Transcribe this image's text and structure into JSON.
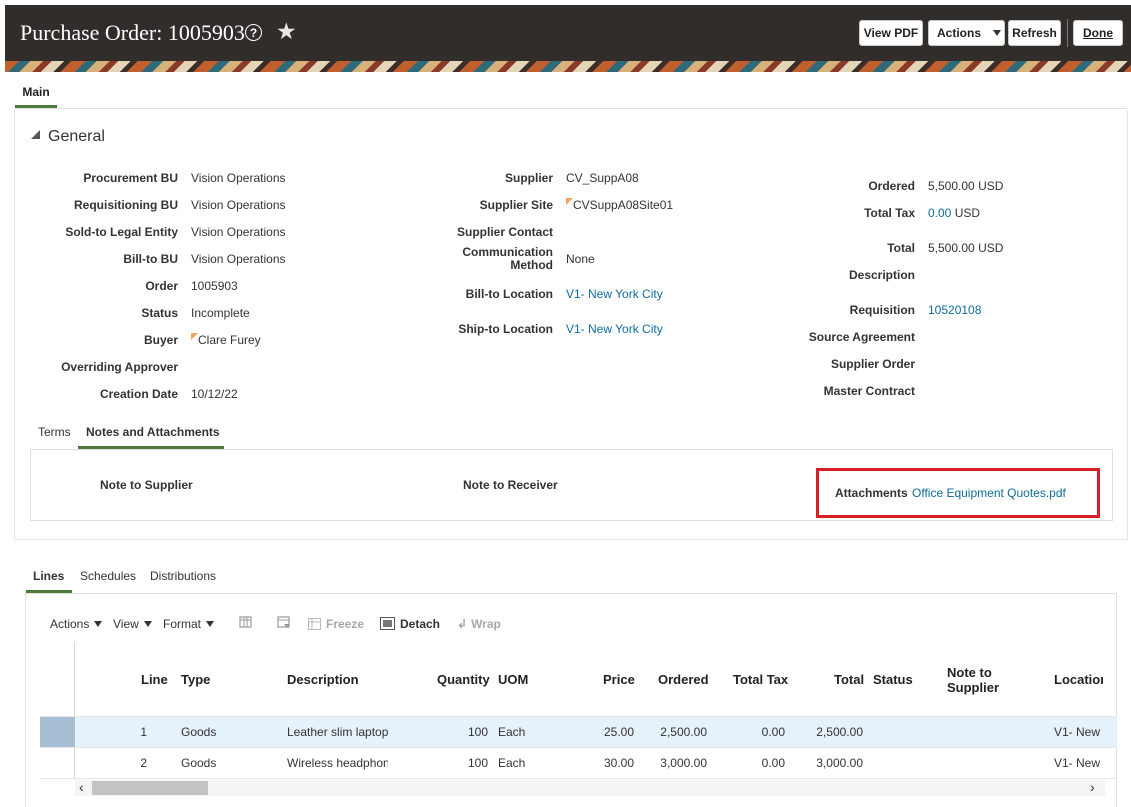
{
  "header": {
    "title": "Purchase Order: 1005903",
    "help_glyph": "?",
    "star_glyph": "★",
    "buttons": {
      "view_pdf": "View PDF",
      "actions": "Actions",
      "refresh": "Refresh",
      "done": "Done"
    }
  },
  "tabs": {
    "main": "Main"
  },
  "general": {
    "title": "General",
    "left": [
      {
        "label": "Procurement BU",
        "value": "Vision Operations"
      },
      {
        "label": "Requisitioning BU",
        "value": "Vision Operations"
      },
      {
        "label": "Sold-to Legal Entity",
        "value": "Vision Operations"
      },
      {
        "label": "Bill-to BU",
        "value": "Vision Operations"
      },
      {
        "label": "Order",
        "value": "1005903"
      },
      {
        "label": "Status",
        "value": "Incomplete"
      },
      {
        "label": "Buyer",
        "value": "Clare Furey"
      },
      {
        "label": "Overriding Approver",
        "value": ""
      },
      {
        "label": "Creation Date",
        "value": "10/12/22"
      }
    ],
    "middle": {
      "supplier": {
        "label": "Supplier",
        "value": "CV_SuppA08"
      },
      "supplier_site": {
        "label": "Supplier Site",
        "value": "CVSuppA08Site01"
      },
      "supplier_contact": {
        "label": "Supplier Contact",
        "value": ""
      },
      "comm_method": {
        "label_1": "Communication",
        "label_2": "Method",
        "value": "None"
      },
      "bill_to": {
        "label": "Bill-to Location",
        "value": "V1- New York City"
      },
      "ship_to": {
        "label": "Ship-to Location",
        "value": "V1- New York City"
      }
    },
    "right": {
      "ordered": {
        "label": "Ordered",
        "value": "5,500.00",
        "currency": "USD"
      },
      "total_tax": {
        "label": "Total Tax",
        "value": "0.00",
        "currency": "USD"
      },
      "total": {
        "label": "Total",
        "value": "5,500.00",
        "currency": "USD"
      },
      "description": {
        "label": "Description",
        "value": ""
      },
      "requisition": {
        "label": "Requisition",
        "value": "10520108"
      },
      "source_agreement": {
        "label": "Source Agreement",
        "value": ""
      },
      "supplier_order": {
        "label": "Supplier Order",
        "value": ""
      },
      "master_contract": {
        "label": "Master Contract",
        "value": ""
      }
    }
  },
  "subtabs": {
    "terms": "Terms",
    "notes": "Notes and Attachments"
  },
  "notes": {
    "note_to_supplier": "Note to Supplier",
    "note_to_receiver": "Note to Receiver",
    "attachments_label": "Attachments",
    "attachment_file": "Office Equipment Quotes.pdf"
  },
  "lines_tabs": {
    "lines": "Lines",
    "schedules": "Schedules",
    "distributions": "Distributions"
  },
  "toolbar": {
    "actions": "Actions",
    "view": "View",
    "format": "Format",
    "freeze": "Freeze",
    "detach": "Detach",
    "wrap": "Wrap"
  },
  "table": {
    "headers": {
      "line": "Line",
      "type": "Type",
      "description": "Description",
      "quantity": "Quantity",
      "uom": "UOM",
      "price": "Price",
      "ordered": "Ordered",
      "total_tax": "Total Tax",
      "total": "Total",
      "status": "Status",
      "note_1": "Note to",
      "note_2": "Supplier",
      "location": "Location"
    },
    "rows": [
      {
        "line": "1",
        "type": "Goods",
        "description": "Leather slim laptop",
        "quantity": "100",
        "uom": "Each",
        "price": "25.00",
        "ordered": "2,500.00",
        "total_tax": "0.00",
        "total": "2,500.00",
        "status": "",
        "note": "",
        "location": "V1- New"
      },
      {
        "line": "2",
        "type": "Goods",
        "description": "Wireless headphone",
        "quantity": "100",
        "uom": "Each",
        "price": "30.00",
        "ordered": "3,000.00",
        "total_tax": "0.00",
        "total": "3,000.00",
        "status": "",
        "note": "",
        "location": "V1- New"
      }
    ]
  },
  "colors": {
    "header_bg": "#312d2a",
    "accent_green": "#4b7b3d",
    "link": "#0e6c9c",
    "highlight_red": "#d81f26",
    "selected_row": "#e5f1fb"
  }
}
